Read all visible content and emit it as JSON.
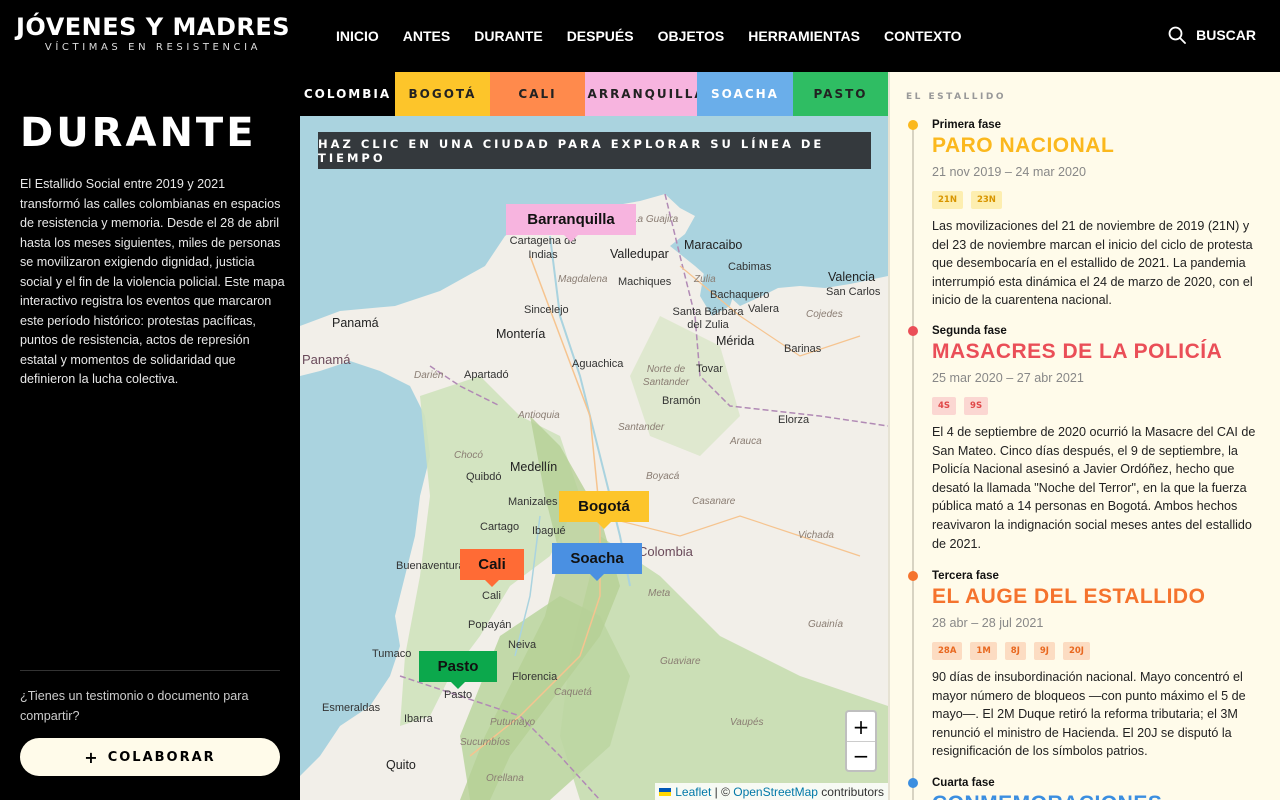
{
  "header": {
    "logo_title": "JÓVENES Y MADRES",
    "logo_subtitle": "VÍCTIMAS EN RESISTENCIA",
    "nav": [
      "INICIO",
      "ANTES",
      "DURANTE",
      "DESPUÉS",
      "OBJETOS",
      "HERRAMIENTAS",
      "CONTEXTO"
    ],
    "search_label": "BUSCAR"
  },
  "sidebar": {
    "title": "DURANTE",
    "intro": "El Estallido Social entre 2019 y 2021 transformó las calles colombianas en espacios de resistencia y memoria. Desde el 28 de abril hasta los meses siguientes, miles de personas se movilizaron exigiendo dignidad, justicia social y el fin de la violencia policial. Este mapa interactivo registra los eventos que marcaron este período histórico: protestas pacíficas, puntos de resistencia, actos de represión estatal y momentos de solidaridad que definieron la lucha colectiva.",
    "ask": "¿Tienes un testimonio o documento para compartir?",
    "collab_label": "COLABORAR"
  },
  "tabs": [
    {
      "label": "COLOMBIA",
      "color": "#000000",
      "text": "#ffffff",
      "width": 95
    },
    {
      "label": "BOGOTÁ",
      "color": "#fdc52a",
      "text": "#222222",
      "width": 95
    },
    {
      "label": "CALI",
      "color": "#ff8a4c",
      "text": "#222222",
      "width": 95
    },
    {
      "label": "BARRANQUILLA",
      "color": "#f7b4df",
      "text": "#222222",
      "width": 112
    },
    {
      "label": "SOACHA",
      "color": "#6aaeea",
      "text": "#ffffff",
      "width": 96
    },
    {
      "label": "PASTO",
      "color": "#2fbd63",
      "text": "#222222",
      "width": 95
    }
  ],
  "map": {
    "hint": "HAZ CLIC EN UNA CIUDAD PARA EXPLORAR SU LÍNEA DE TIEMPO",
    "pins": [
      {
        "label": "Barranquilla",
        "color": "#f7b4df"
      },
      {
        "label": "Bogotá",
        "color": "#fdc52a"
      },
      {
        "label": "Soacha",
        "color": "#4a90e2"
      },
      {
        "label": "Cali",
        "color": "#ff6b35"
      },
      {
        "label": "Pasto",
        "color": "#0ca84c"
      }
    ],
    "places": {
      "cartagena": "Cartagena de Indias",
      "laguajira": "La Guajira",
      "maracaibo": "Maracaibo",
      "valledupar": "Valledupar",
      "cabimas": "Cabimas",
      "valencia": "Valencia",
      "sancarlos": "San Carlos",
      "magdalena": "Magdalena",
      "machiques": "Machiques",
      "zulia": "Zulia",
      "bachaquero": "Bachaquero",
      "sincelejo": "Sincelejo",
      "santabarbara": "Santa Bárbara del Zulia",
      "valera": "Valera",
      "cojedes": "Cojedes",
      "panama": "Panamá",
      "panamacountry": "Panamá",
      "monteria": "Montería",
      "merida": "Mérida",
      "barinas": "Barinas",
      "aguachica": "Aguachica",
      "nortesantander": "Norte de Santander",
      "tovar": "Tovar",
      "darien": "Darién",
      "apartado": "Apartadó",
      "antioquia": "Antioquia",
      "bramon": "Bramón",
      "santander": "Santander",
      "elorza": "Elorza",
      "arauca": "Arauca",
      "choco": "Chocó",
      "medellin": "Medellín",
      "quibdo": "Quibdó",
      "boyaca": "Boyacá",
      "manizales": "Manizales",
      "casanare": "Casanare",
      "cartago": "Cartago",
      "ibague": "Ibagué",
      "colombia": "Colombia",
      "buenaventura": "Buenaventura",
      "vichada": "Vichada",
      "cali": "Cali",
      "meta": "Meta",
      "popayan": "Popayán",
      "guainia": "Guainía",
      "tumaco": "Tumaco",
      "neiva": "Neiva",
      "florencia": "Florencia",
      "guaviare": "Guaviare",
      "pasto": "Pasto",
      "caqueta": "Caquetá",
      "esmeraldas": "Esmeraldas",
      "putumayo": "Putumayo",
      "ibarra": "Ibarra",
      "vaupes": "Vaupés",
      "sucumbios": "Sucumbíos",
      "quito": "Quito",
      "orellana": "Orellana"
    },
    "zoom_in": "+",
    "zoom_out": "−",
    "attribution_leaflet": "Leaflet",
    "attribution_sep": " | © ",
    "attribution_osm": "OpenStreetMap",
    "attribution_tail": " contributors"
  },
  "panel": {
    "label": "EL ESTALLIDO",
    "phases": [
      {
        "num": "Primera fase",
        "title": "PARO NACIONAL",
        "color": "#fbb81d",
        "date": "21 nov 2019 – 24 mar 2020",
        "chips": [
          "21N",
          "23N"
        ],
        "chip_bg": "#fdeeb0",
        "chip_fg": "#d89500",
        "text": "Las movilizaciones del 21 de noviembre de 2019 (21N) y del 23 de noviembre marcan el inicio del ciclo de protesta que desembocaría en el estallido de 2021. La pandemia interrumpió esta dinámica el 24 de marzo de 2020, con el inicio de la cuarentena nacional."
      },
      {
        "num": "Segunda fase",
        "title": "MASACRES DE LA POLICÍA",
        "color": "#ea4e57",
        "date": "25 mar 2020 – 27 abr 2021",
        "chips": [
          "4S",
          "9S"
        ],
        "chip_bg": "#fbd7d2",
        "chip_fg": "#e04848",
        "text": "El 4 de septiembre de 2020 ocurrió la Masacre del CAI de San Mateo. Cinco días después, el 9 de septiembre, la Policía Nacional asesinó a Javier Ordóñez, hecho que desató la llamada \"Noche del Terror\", en la que la fuerza pública mató a 14 personas en Bogotá. Ambos hechos reavivaron la indignación social meses antes del estallido de 2021."
      },
      {
        "num": "Tercera fase",
        "title": "EL AUGE DEL ESTALLIDO",
        "color": "#f5732d",
        "date": "28 abr – 28 jul 2021",
        "chips": [
          "28A",
          "1M",
          "8J",
          "9J",
          "20J"
        ],
        "chip_bg": "#fcdcc2",
        "chip_fg": "#e8681f",
        "text": "90 días de insubordinación nacional. Mayo concentró el mayor número de bloqueos —con punto máximo el 5 de mayo—. El 2M Duque retiró la reforma tributaria; el 3M renunció el ministro de Hacienda. El 20J se disputó la resignificación de los símbolos patrios."
      },
      {
        "num": "Cuarta fase",
        "title": "CONMEMORACIONES",
        "color": "#3b8ee0",
        "date": "",
        "chips": [],
        "chip_bg": "#d4e6f8",
        "chip_fg": "#3b8ee0",
        "text": ""
      }
    ]
  }
}
